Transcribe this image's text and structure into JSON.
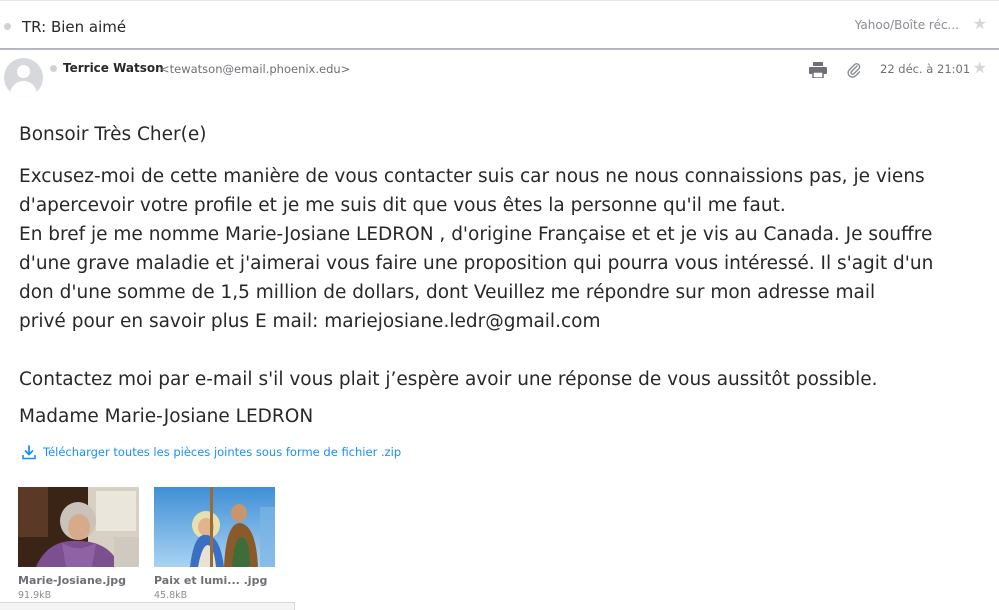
{
  "header": {
    "subject": "TR: Bien aimé",
    "folder": "Yahoo/Boîte réc...",
    "star_icon": "star-icon"
  },
  "sender": {
    "name": "Terrice Watson",
    "email": "<tewatson@email.phoenix.edu>",
    "date": "22 déc. à 21:01",
    "avatar_icon": "avatar-icon",
    "print_icon": "print-icon",
    "attachment_icon": "paperclip-icon"
  },
  "message": {
    "greeting": "Bonsoir Très Cher(e)",
    "lines": [
      "Excusez-moi de cette manière de vous contacter suis car nous ne nous connaissions pas, je viens",
      "d'apercevoir votre profile et je me suis dit que vous êtes la personne qu'il me faut.",
      "En bref je me nomme Marie-Josiane LEDRON , d'origine Française et et je vis au Canada. Je souffre",
      "d'une grave maladie et j'aimerai vous faire une proposition qui pourra vous intéressé. Il s'agit d'un",
      "don d'une somme de 1,5 million de dollars, dont  Veuillez me répondre sur mon adresse mail",
      "privé pour en savoir plus E mail: mariejosiane.ledr@gmail.com"
    ],
    "contact_line": "Contactez moi par e-mail s'il vous plait j’espère avoir une réponse de vous aussitôt possible.",
    "signature": "Madame Marie-Josiane LEDRON"
  },
  "attachments": {
    "download_all_label": "Télécharger toutes les pièces jointes sous forme de fichier .zip",
    "download_icon": "download-icon",
    "items": [
      {
        "name": "Marie-Josiane.jpg",
        "size": "91.9kB"
      },
      {
        "name": "Paix et lumi...  .jpg",
        "size": "45.8kB"
      }
    ]
  },
  "colors": {
    "link": "#188fff",
    "text": "#26282a",
    "muted": "#6e7075"
  }
}
